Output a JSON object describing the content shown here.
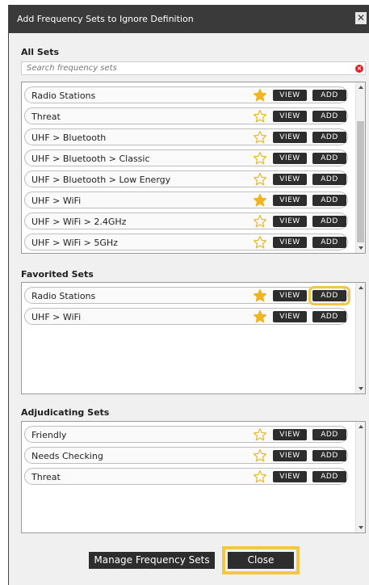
{
  "dialog": {
    "title": "Add Frequency Sets to Ignore Definition",
    "close_glyph": "✕"
  },
  "all_sets": {
    "label": "All Sets",
    "search_placeholder": "Search frequency sets",
    "items": [
      {
        "label": "Radio Stations",
        "favorited": true,
        "view": "VIEW",
        "add": "ADD"
      },
      {
        "label": "Threat",
        "favorited": false,
        "view": "VIEW",
        "add": "ADD"
      },
      {
        "label": "UHF > Bluetooth",
        "favorited": false,
        "view": "VIEW",
        "add": "ADD"
      },
      {
        "label": "UHF > Bluetooth > Classic",
        "favorited": false,
        "view": "VIEW",
        "add": "ADD"
      },
      {
        "label": "UHF > Bluetooth > Low Energy",
        "favorited": false,
        "view": "VIEW",
        "add": "ADD"
      },
      {
        "label": "UHF > WiFi",
        "favorited": true,
        "view": "VIEW",
        "add": "ADD"
      },
      {
        "label": "UHF > WiFi > 2.4GHz",
        "favorited": false,
        "view": "VIEW",
        "add": "ADD"
      },
      {
        "label": "UHF > WiFi > 5GHz",
        "favorited": false,
        "view": "VIEW",
        "add": "ADD"
      }
    ]
  },
  "favorited_sets": {
    "label": "Favorited Sets",
    "items": [
      {
        "label": "Radio Stations",
        "favorited": true,
        "view": "VIEW",
        "add": "ADD",
        "highlighted": true
      },
      {
        "label": "UHF > WiFi",
        "favorited": true,
        "view": "VIEW",
        "add": "ADD"
      }
    ]
  },
  "adjudicating_sets": {
    "label": "Adjudicating Sets",
    "items": [
      {
        "label": "Friendly",
        "favorited": false,
        "view": "VIEW",
        "add": "ADD"
      },
      {
        "label": "Needs Checking",
        "favorited": false,
        "view": "VIEW",
        "add": "ADD"
      },
      {
        "label": "Threat",
        "favorited": false,
        "view": "VIEW",
        "add": "ADD"
      }
    ]
  },
  "footer": {
    "manage_label": "Manage Frequency Sets",
    "close_label": "Close"
  },
  "colors": {
    "star_filled": "#f0b51f",
    "star_outline": "#e8b830",
    "highlight": "#f3c746",
    "button_dark": "#2d2d2d",
    "titlebar": "#3a3a3a"
  },
  "icons": {
    "favorite": "star-icon",
    "clear": "clear-search-icon",
    "close": "close-icon"
  }
}
